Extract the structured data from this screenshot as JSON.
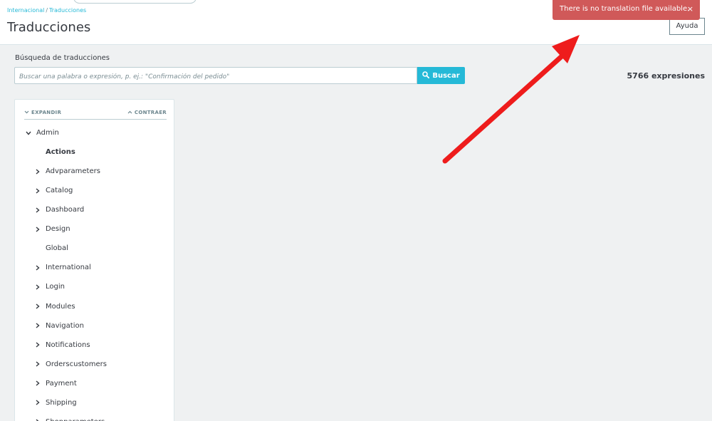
{
  "header": {
    "breadcrumb": [
      "Internacional",
      "Traducciones"
    ],
    "title": "Traducciones",
    "help_label": "Ayuda"
  },
  "toast": {
    "message": "There is no translation file available.",
    "close": "×",
    "color": "#d05959"
  },
  "search": {
    "label": "Búsqueda de traducciones",
    "placeholder": "Buscar una palabra o expresión, p. ej.: \"Confirmación del pedido\"",
    "button_label": "Buscar",
    "button_icon": "search-icon",
    "accent": "#25b9d7"
  },
  "count_label": "5766 expresiones",
  "tree": {
    "expand_label": "EXPANDIR",
    "collapse_label": "CONTRAER",
    "root": {
      "label": "Admin",
      "icon": "chevron-down-icon"
    },
    "items": [
      {
        "label": "Actions",
        "has_children": false,
        "active": true
      },
      {
        "label": "Advparameters",
        "has_children": true
      },
      {
        "label": "Catalog",
        "has_children": true
      },
      {
        "label": "Dashboard",
        "has_children": true
      },
      {
        "label": "Design",
        "has_children": true
      },
      {
        "label": "Global",
        "has_children": false
      },
      {
        "label": "International",
        "has_children": true
      },
      {
        "label": "Login",
        "has_children": true
      },
      {
        "label": "Modules",
        "has_children": true
      },
      {
        "label": "Navigation",
        "has_children": true
      },
      {
        "label": "Notifications",
        "has_children": true
      },
      {
        "label": "Orderscustomers",
        "has_children": true
      },
      {
        "label": "Payment",
        "has_children": true
      },
      {
        "label": "Shipping",
        "has_children": true
      },
      {
        "label": "Shopparameters",
        "has_children": true
      }
    ]
  },
  "annotation": {
    "color": "#ee1c1c"
  }
}
